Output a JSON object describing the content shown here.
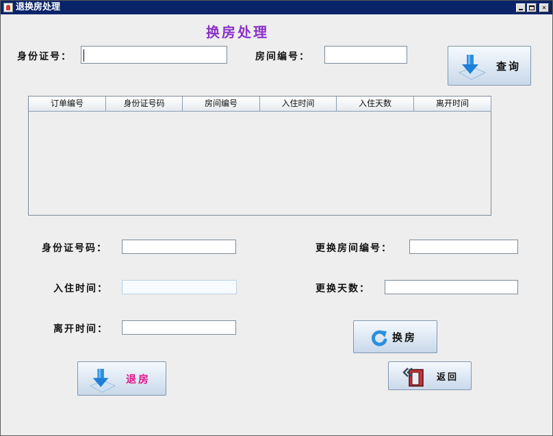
{
  "window": {
    "title": "退换房处理"
  },
  "heading": "换房处理",
  "search": {
    "id_label": "身份证号：",
    "id_value": "",
    "room_label": "房间编号：",
    "room_value": "",
    "query_button": "查询"
  },
  "table": {
    "columns": [
      "订单编号",
      "身份证号码",
      "房间编号",
      "入住时间",
      "入住天数",
      "离开时间"
    ],
    "rows": []
  },
  "form": {
    "id_label": "身份证号码：",
    "id_value": "",
    "checkin_label": "入住时间：",
    "checkin_value": "",
    "leave_label": "离开时间：",
    "leave_value": "",
    "new_room_label": "更换房间编号：",
    "new_room_value": "",
    "change_days_label": "更换天数：",
    "change_days_value": ""
  },
  "buttons": {
    "change_room": "换房",
    "checkout": "退房",
    "back": "返回"
  },
  "colors": {
    "heading": "#8b30c8",
    "checkout_text": "#e0188c",
    "titlebar": "#0a246a"
  },
  "icons": {
    "query": "download-arrow-icon",
    "change_room": "refresh-icon",
    "checkout": "download-arrow-icon",
    "back": "exit-door-icon"
  }
}
